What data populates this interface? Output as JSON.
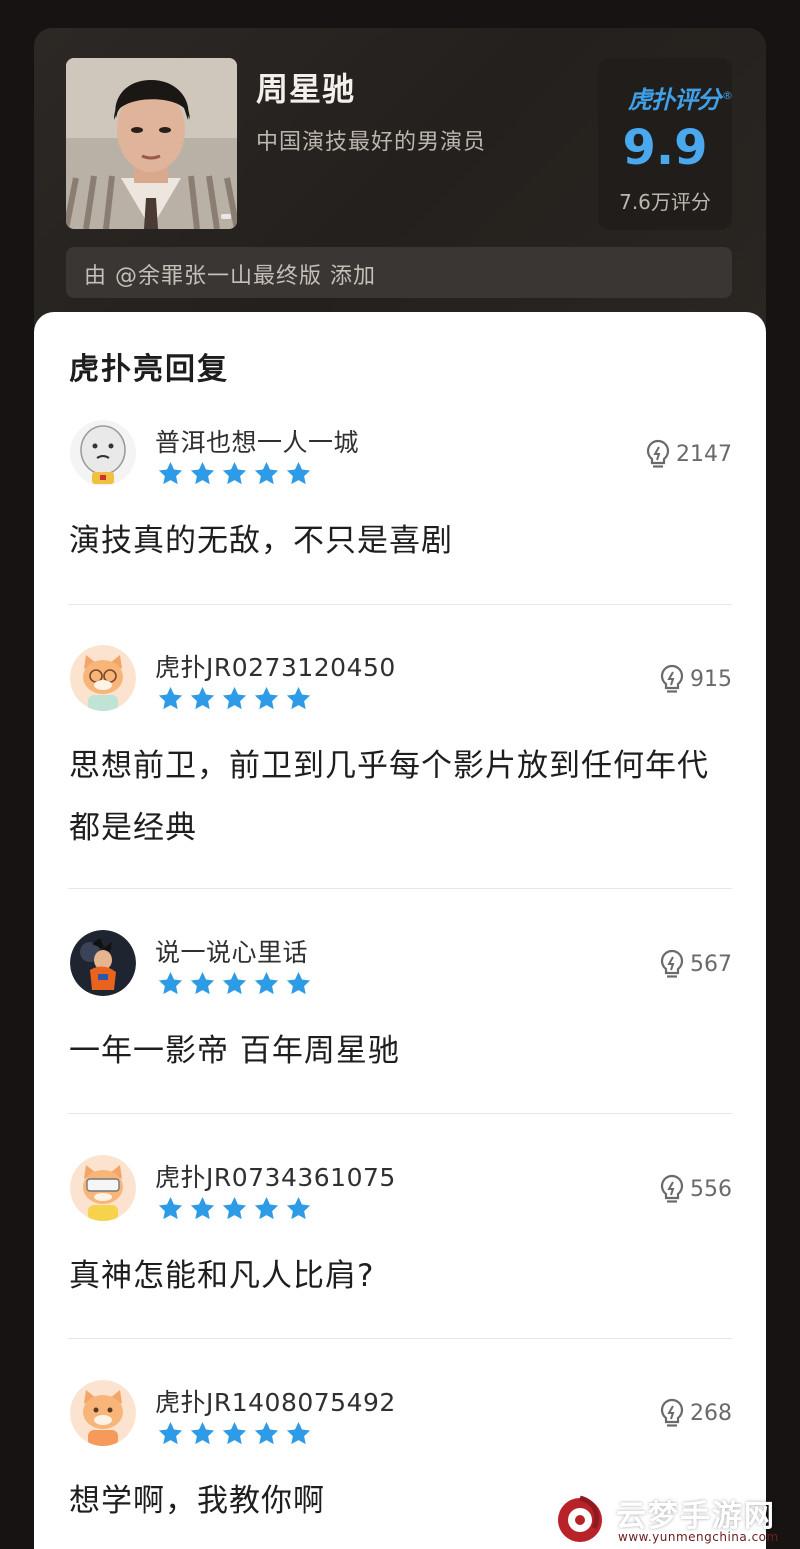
{
  "celebrity": {
    "name": "周星驰",
    "description": "中国演技最好的男演员",
    "added_by": "由 @余罪张一山最终版 添加"
  },
  "rating": {
    "brand": "虎扑评分",
    "registered_mark": "®",
    "score": "9.9",
    "count": "7.6万评分"
  },
  "section": {
    "title": "虎扑亮回复"
  },
  "comments": [
    {
      "username": "普洱也想一人一城",
      "stars": 5,
      "likes": "2147",
      "text": "演技真的无敌，不只是喜剧"
    },
    {
      "username": "虎扑JR0273120450",
      "stars": 5,
      "likes": "915",
      "text": "思想前卫，前卫到几乎每个影片放到任何年代都是经典"
    },
    {
      "username": "说一说心里话",
      "stars": 5,
      "likes": "567",
      "text": "一年一影帝 百年周星驰"
    },
    {
      "username": "虎扑JR0734361075",
      "stars": 5,
      "likes": "556",
      "text": "真神怎能和凡人比肩?"
    },
    {
      "username": "虎扑JR1408075492",
      "stars": 5,
      "likes": "268",
      "text": "想学啊，我教你啊"
    }
  ],
  "watermark": {
    "name": "云梦手游网",
    "url": "www.yunmengchina.com"
  },
  "colors": {
    "accent": "#3fa0e8",
    "star": "#2e9be6",
    "background": "#161312"
  }
}
